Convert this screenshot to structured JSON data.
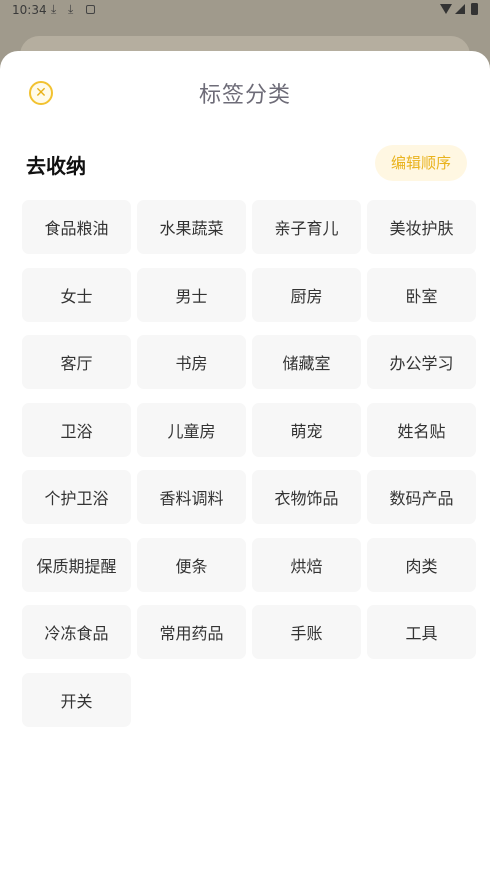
{
  "status": {
    "time": "10:34",
    "dl_icon": "download-icon"
  },
  "sheet": {
    "title": "标签分类",
    "close_icon": "close-icon",
    "section_title": "去收纳",
    "edit_label": "编辑顺序",
    "accent": "#f2c230",
    "tags": [
      "食品粮油",
      "水果蔬菜",
      "亲子育儿",
      "美妆护肤",
      "女士",
      "男士",
      "厨房",
      "卧室",
      "客厅",
      "书房",
      "储藏室",
      "办公学习",
      "卫浴",
      "儿童房",
      "萌宠",
      "姓名贴",
      "个护卫浴",
      "香料调料",
      "衣物饰品",
      "数码产品",
      "保质期提醒",
      "便条",
      "烘焙",
      "肉类",
      "冷冻食品",
      "常用药品",
      "手账",
      "工具",
      "开关"
    ]
  }
}
